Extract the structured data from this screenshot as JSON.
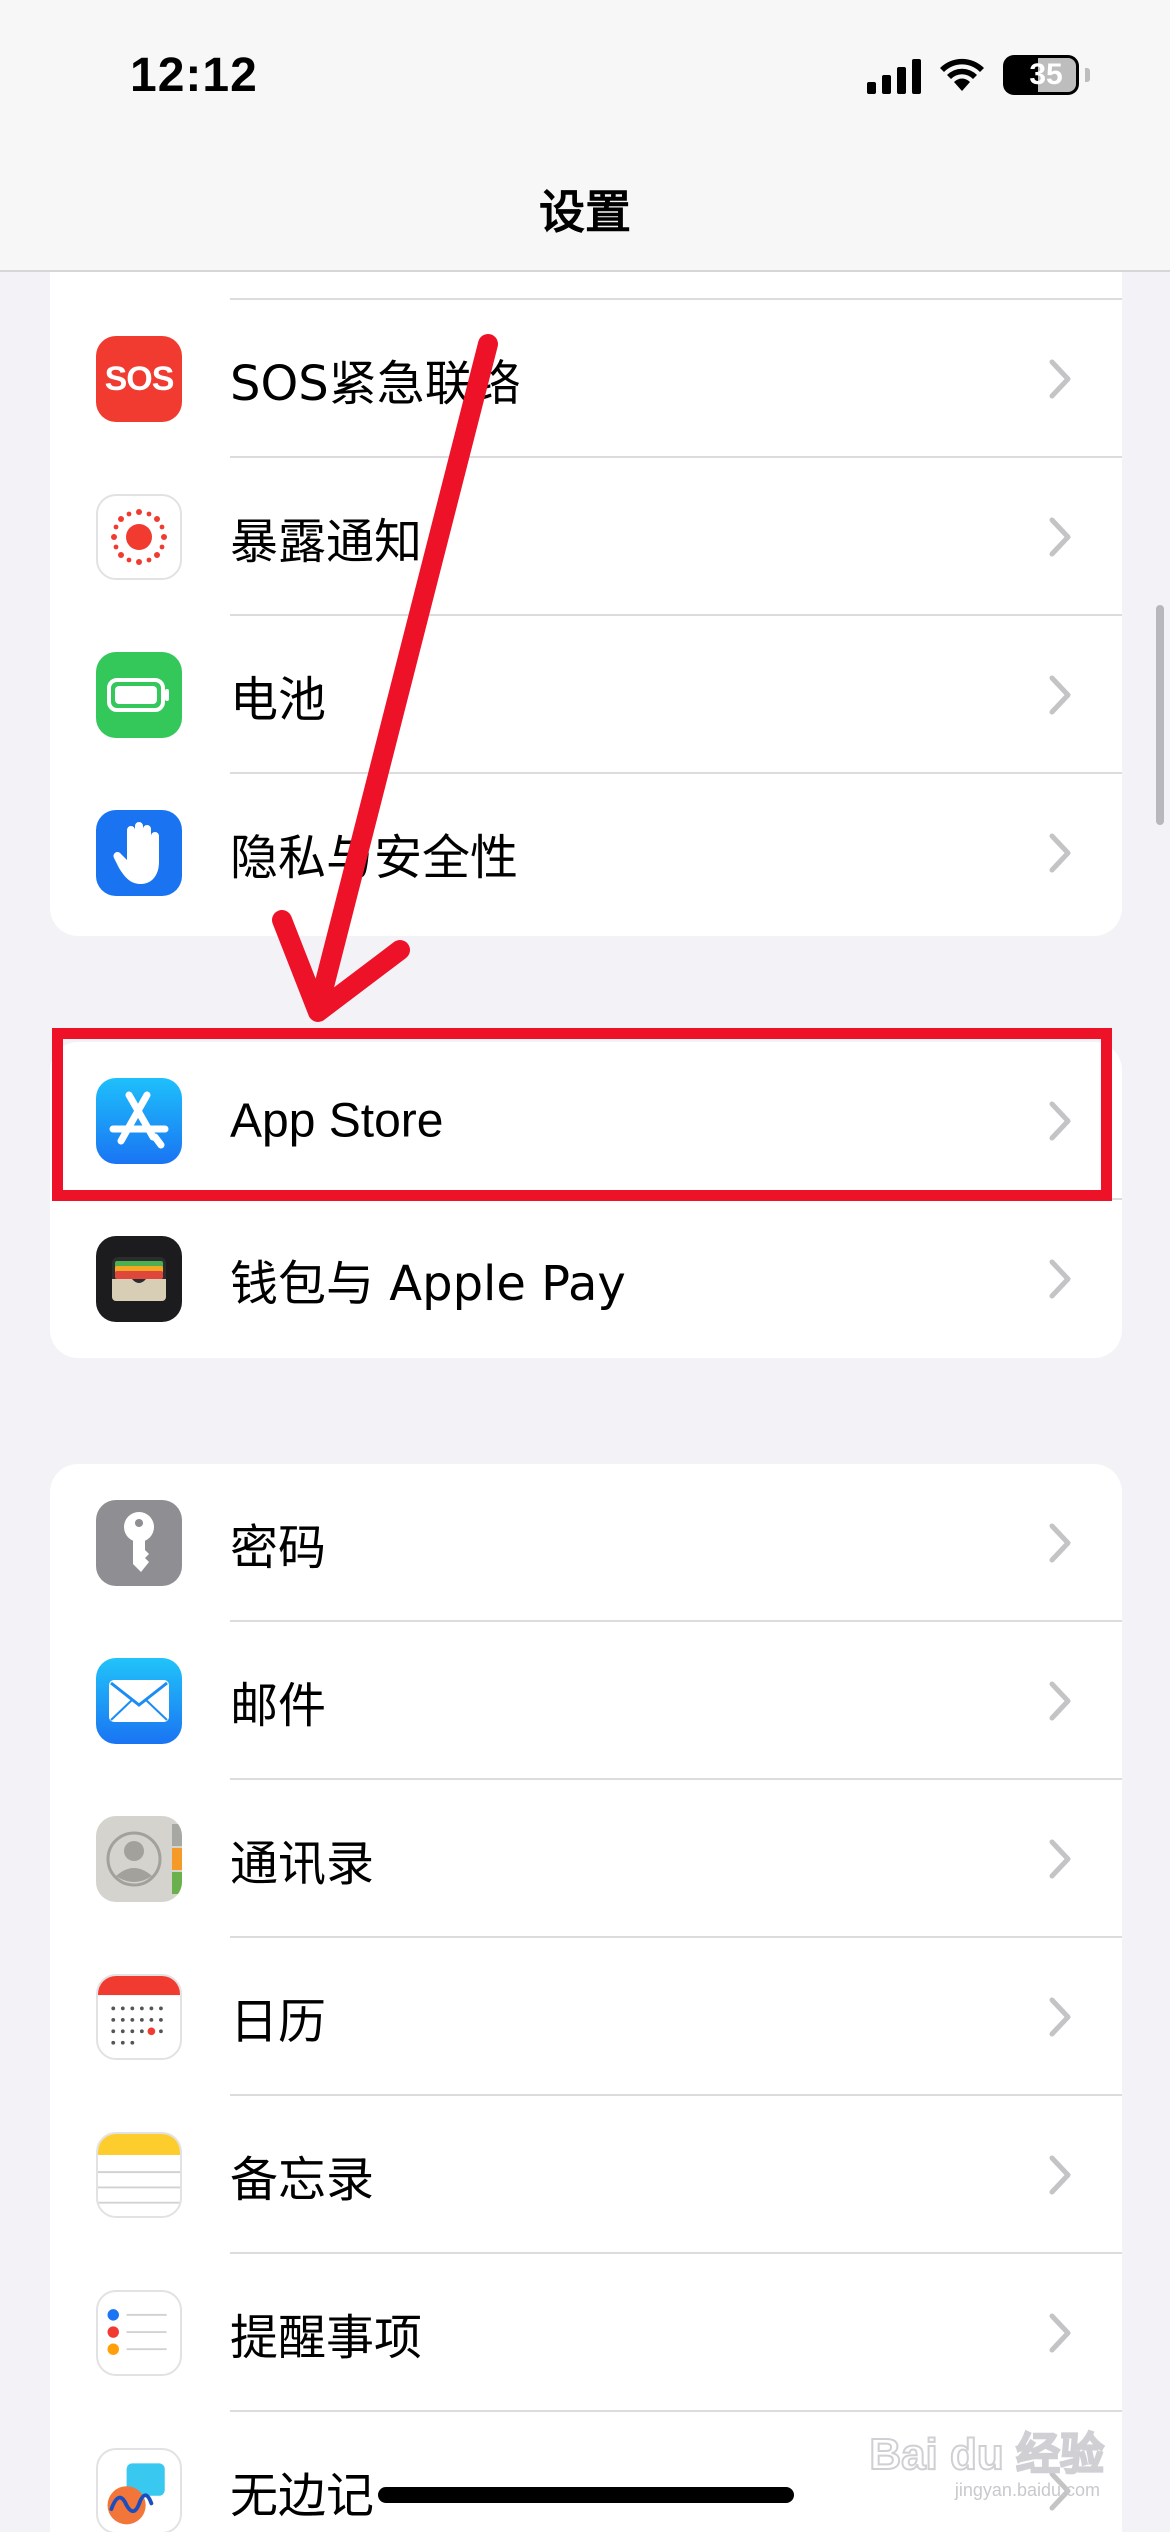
{
  "status_bar": {
    "time": "12:12",
    "battery": "35"
  },
  "nav": {
    "title": "设置"
  },
  "group1": [
    {
      "label": "SOS紧急联络",
      "icon": "sos-icon",
      "color": "#f13b30"
    },
    {
      "label": "暴露通知",
      "icon": "exposure-icon",
      "color": "#ffffff"
    },
    {
      "label": "电池",
      "icon": "battery-icon",
      "color": "#34c759"
    },
    {
      "label": "隐私与安全性",
      "icon": "hand-icon",
      "color": "#1a73f0"
    }
  ],
  "group2": [
    {
      "label": "App Store",
      "icon": "app-store-icon",
      "color": "#1b8cf6"
    },
    {
      "label": "钱包与 Apple Pay",
      "icon": "wallet-icon",
      "color": "#1c1c1e"
    }
  ],
  "group3": [
    {
      "label": "密码",
      "icon": "key-icon",
      "color": "#8e8e93"
    },
    {
      "label": "邮件",
      "icon": "mail-icon",
      "color": "#1f8ff5"
    },
    {
      "label": "通讯录",
      "icon": "contacts-icon",
      "color": "#d4d3ce"
    },
    {
      "label": "日历",
      "icon": "calendar-icon",
      "color": "#ffffff"
    },
    {
      "label": "备忘录",
      "icon": "notes-icon",
      "color": "#ffffff"
    },
    {
      "label": "提醒事项",
      "icon": "reminders-icon",
      "color": "#ffffff"
    },
    {
      "label": "无边记",
      "icon": "freeform-icon",
      "color": "#ffffff"
    }
  ],
  "watermark": {
    "text": "Bai du 经验",
    "url": "jingyan.baidu.com"
  },
  "annotation": {
    "highlight_color": "#ee1229"
  }
}
